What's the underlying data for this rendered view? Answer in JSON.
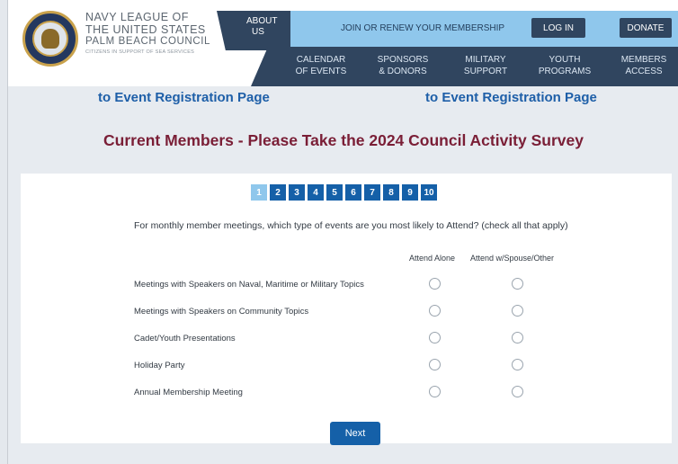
{
  "brand": {
    "line1": "NAVY LEAGUE OF",
    "line2": "THE UNITED STATES",
    "line3": "PALM BEACH COUNCIL",
    "tagline": "CITIZENS IN SUPPORT OF SEA SERVICES"
  },
  "nav": {
    "about": "ABOUT US",
    "join": "JOIN OR RENEW YOUR MEMBERSHIP",
    "login": "LOG IN",
    "donate": "DONATE",
    "items": [
      {
        "label": "CALENDAR OF EVENTS"
      },
      {
        "label": "SPONSORS & DONORS"
      },
      {
        "label": "MILITARY SUPPORT"
      },
      {
        "label": "YOUTH PROGRAMS"
      },
      {
        "label": "MEMBERS ACCESS"
      }
    ]
  },
  "links": {
    "left": "to Event Registration Page",
    "right": "to Event Registration Page"
  },
  "survey": {
    "title": "Current Members - Please Take the 2024 Council Activity Survey",
    "pages": [
      "1",
      "2",
      "3",
      "4",
      "5",
      "6",
      "7",
      "8",
      "9",
      "10"
    ],
    "current_page": 1,
    "question": "For monthly member meetings, which type of events are you most likely to Attend? (check all that apply)",
    "columns": [
      "Attend Alone",
      "Attend w/Spouse/Other"
    ],
    "rows": [
      {
        "label": "Meetings with Speakers on Naval, Maritime or Military Topics"
      },
      {
        "label": "Meetings with Speakers on Community Topics"
      },
      {
        "label": "Cadet/Youth Presentations"
      },
      {
        "label": "Holiday Party"
      },
      {
        "label": "Annual Membership Meeting"
      }
    ],
    "next": "Next"
  },
  "colors": {
    "nav_dark": "#30455f",
    "nav_light": "#8fc7ec",
    "link_blue": "#1e5fa8",
    "title_maroon": "#7a1e36",
    "button_blue": "#1560a8"
  }
}
